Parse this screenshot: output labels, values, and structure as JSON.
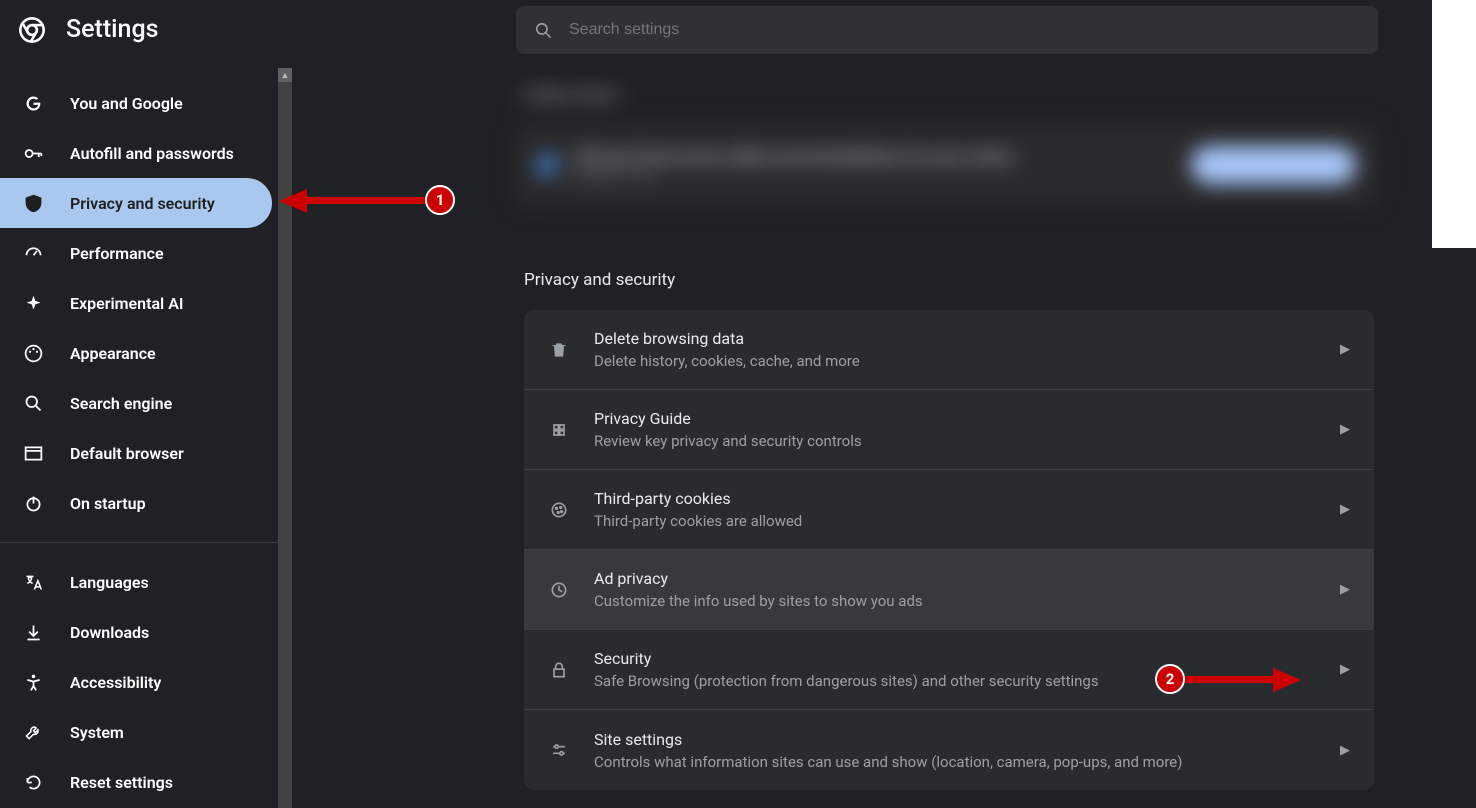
{
  "app_title": "Settings",
  "search_placeholder": "Search settings",
  "sidebar": {
    "items": [
      {
        "label": "You and Google"
      },
      {
        "label": "Autofill and passwords"
      },
      {
        "label": "Privacy and security"
      },
      {
        "label": "Performance"
      },
      {
        "label": "Experimental AI"
      },
      {
        "label": "Appearance"
      },
      {
        "label": "Search engine"
      },
      {
        "label": "Default browser"
      },
      {
        "label": "On startup"
      },
      {
        "label": "Languages"
      },
      {
        "label": "Downloads"
      },
      {
        "label": "Accessibility"
      },
      {
        "label": "System"
      },
      {
        "label": "Reset settings"
      }
    ]
  },
  "safety_check": {
    "heading": "Safety Check",
    "line1": "Chrome found some safety recommendations for your review",
    "line2": "Review now"
  },
  "section_heading": "Privacy and security",
  "rows": [
    {
      "title": "Delete browsing data",
      "subtitle": "Delete history, cookies, cache, and more"
    },
    {
      "title": "Privacy Guide",
      "subtitle": "Review key privacy and security controls"
    },
    {
      "title": "Third-party cookies",
      "subtitle": "Third-party cookies are allowed"
    },
    {
      "title": "Ad privacy",
      "subtitle": "Customize the info used by sites to show you ads"
    },
    {
      "title": "Security",
      "subtitle": "Safe Browsing (protection from dangerous sites) and other security settings"
    },
    {
      "title": "Site settings",
      "subtitle": "Controls what information sites can use and show (location, camera, pop-ups, and more)"
    }
  ],
  "callouts": {
    "one": "1",
    "two": "2"
  }
}
